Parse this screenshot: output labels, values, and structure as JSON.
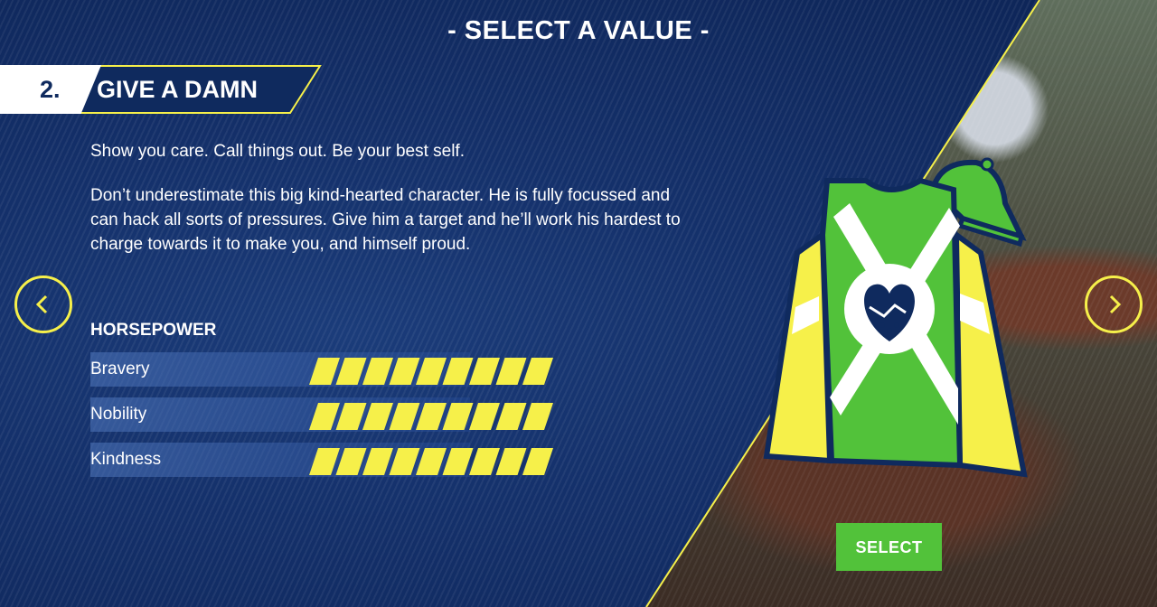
{
  "title": "- SELECT A VALUE -",
  "value": {
    "number": "2.",
    "name": "GIVE A DAMN",
    "tagline": "Show you care. Call things out. Be your best self.",
    "description": "Don’t underestimate this big kind-hearted character. He is fully focussed and can hack all sorts of pressures. Give him a target and he’ll work his hardest to charge towards it to make you, and himself proud."
  },
  "horsepower": {
    "title": "HORSEPOWER",
    "stats": [
      {
        "label": "Bravery",
        "filled": 9,
        "max": 9
      },
      {
        "label": "Nobility",
        "filled": 9,
        "max": 9
      },
      {
        "label": "Kindness",
        "filled": 9,
        "max": 9
      }
    ]
  },
  "nav": {
    "prev_icon": "chevron-left-icon",
    "next_icon": "chevron-right-icon"
  },
  "jersey": {
    "emblem_icon": "heart-handshake-icon",
    "body_color": "#52c23a",
    "sleeve_color": "#f6f04a",
    "sash_color": "#ffffff"
  },
  "select_button": "SELECT",
  "colors": {
    "accent": "#f6f04a",
    "navy": "#0f2a5e",
    "green": "#52c23a"
  }
}
